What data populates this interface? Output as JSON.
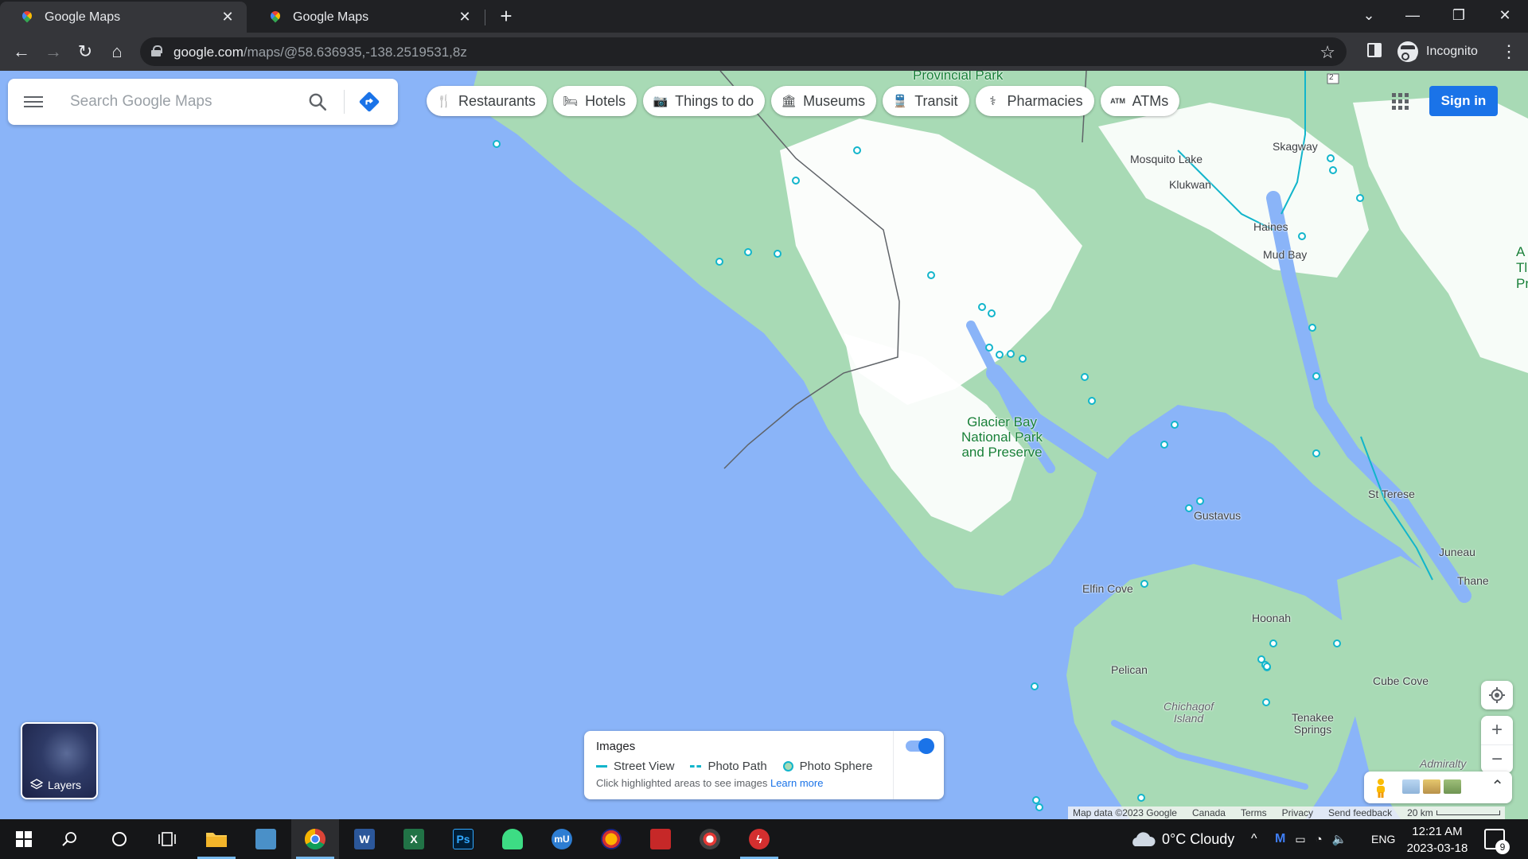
{
  "browser": {
    "tabs": [
      {
        "title": "Google Maps",
        "close": "✕"
      },
      {
        "title": "Google Maps",
        "close": "✕"
      }
    ],
    "new_tab": "+",
    "window_controls": {
      "dropdown": "⌄",
      "minimize": "—",
      "restore": "❐",
      "close": "✕"
    },
    "nav": {
      "back": "←",
      "forward": "→",
      "reload": "↻",
      "home": "⌂"
    },
    "url_domain": "google.com",
    "url_path": "/maps/@58.636935,-138.2519531,8z",
    "bookmark_icon": "☆",
    "incognito_label": "Incognito",
    "menu": "⋮"
  },
  "maps": {
    "search_placeholder": "Search Google Maps",
    "chips": [
      {
        "icon": "restaurant-icon",
        "glyph": "🍴",
        "label": "Restaurants"
      },
      {
        "icon": "hotel-icon",
        "glyph": "🛏",
        "label": "Hotels"
      },
      {
        "icon": "camera-icon",
        "glyph": "📷",
        "label": "Things to do"
      },
      {
        "icon": "museum-icon",
        "glyph": "🏛",
        "label": "Museums"
      },
      {
        "icon": "transit-icon",
        "glyph": "🚆",
        "label": "Transit"
      },
      {
        "icon": "pharmacy-icon",
        "glyph": "⚕",
        "label": "Pharmacies"
      },
      {
        "icon": "atm-icon",
        "glyph": "ATM",
        "label": "ATMs"
      }
    ],
    "sign_in": "Sign in",
    "labels": {
      "provincial_park": "Provincial Park",
      "mosquito_lake": "Mosquito Lake",
      "klukwan": "Klukwan",
      "skagway": "Skagway",
      "haines": "Haines",
      "mud_bay": "Mud Bay",
      "glacier_bay_1": "Glacier Bay",
      "glacier_bay_2": "National Park",
      "glacier_bay_3": "and Preserve",
      "gustavus": "Gustavus",
      "st_terese": "St Terese",
      "juneau": "Juneau",
      "thane": "Thane",
      "elfin_cove": "Elfin Cove",
      "hoonah": "Hoonah",
      "pelican": "Pelican",
      "chichagof_1": "Chichagof",
      "chichagof_2": "Island",
      "tenakee_1": "Tenakee",
      "tenakee_2": "Springs",
      "cube_cove": "Cube Cove",
      "admiralty": "Admiralty",
      "edge_a": "A",
      "edge_tl": "Tl",
      "edge_pr": "Pr",
      "route_shield": "2"
    },
    "layers_label": "Layers",
    "images_panel": {
      "title": "Images",
      "street_view": "Street View",
      "photo_path": "Photo Path",
      "photo_sphere": "Photo Sphere",
      "hint": "Click highlighted areas to see images",
      "learn_more": "Learn more",
      "toggle_on": true
    },
    "zoom_in": "+",
    "zoom_out": "−",
    "expand": "⌃",
    "attribution": {
      "map_data": "Map data ©2023 Google",
      "country": "Canada",
      "terms": "Terms",
      "privacy": "Privacy",
      "feedback": "Send feedback",
      "scale": "20 km"
    },
    "colors": {
      "water": "#8ab4f8",
      "land": "#a8dab5",
      "snow": "#ffffff",
      "accent": "#1a73e8"
    }
  },
  "taskbar": {
    "weather": "0°C  Cloudy",
    "language": "ENG",
    "time": "12:21 AM",
    "date": "2023-03-18",
    "notifications": "9",
    "apps": [
      {
        "name": "start-button",
        "glyph": "⊞"
      },
      {
        "name": "search-button",
        "glyph": "⌕"
      },
      {
        "name": "cortana-button",
        "glyph": "○"
      },
      {
        "name": "task-view-button",
        "glyph": "⧉"
      },
      {
        "name": "file-explorer",
        "glyph": "▬"
      },
      {
        "name": "control-panel",
        "glyph": "▣"
      },
      {
        "name": "chrome",
        "glyph": "◉"
      },
      {
        "name": "word",
        "glyph": "W"
      },
      {
        "name": "excel",
        "glyph": "X"
      },
      {
        "name": "photoshop",
        "glyph": "Ps"
      },
      {
        "name": "android-app",
        "glyph": "◈"
      },
      {
        "name": "mu-app",
        "glyph": "mU"
      },
      {
        "name": "vpn-app",
        "glyph": "◐"
      },
      {
        "name": "screen-recorder",
        "glyph": "▶"
      },
      {
        "name": "media-app",
        "glyph": "◎"
      },
      {
        "name": "flash-app",
        "glyph": "ϟ"
      }
    ]
  }
}
